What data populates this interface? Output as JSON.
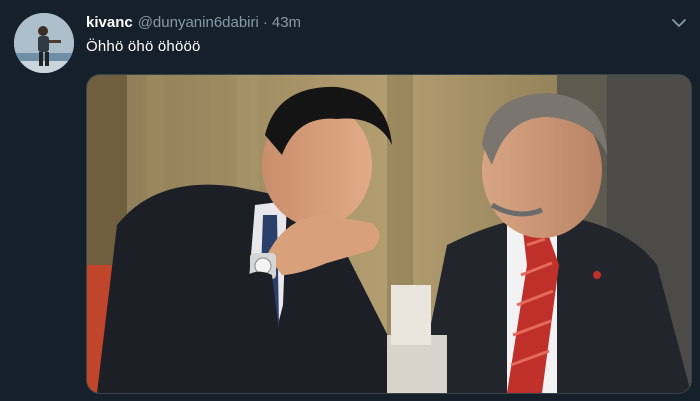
{
  "tweet": {
    "author": {
      "display_name": "kivanc",
      "handle": "@dunyanin6dabiri"
    },
    "separator": "·",
    "time": "43m",
    "text": "Öhhö öhö öhööö",
    "menu_icon": "chevron-down-icon",
    "media": {
      "kind": "photo"
    }
  },
  "colors": {
    "background": "#15202b",
    "text": "#ffffff",
    "muted": "#8899a6",
    "border": "#38444d"
  }
}
